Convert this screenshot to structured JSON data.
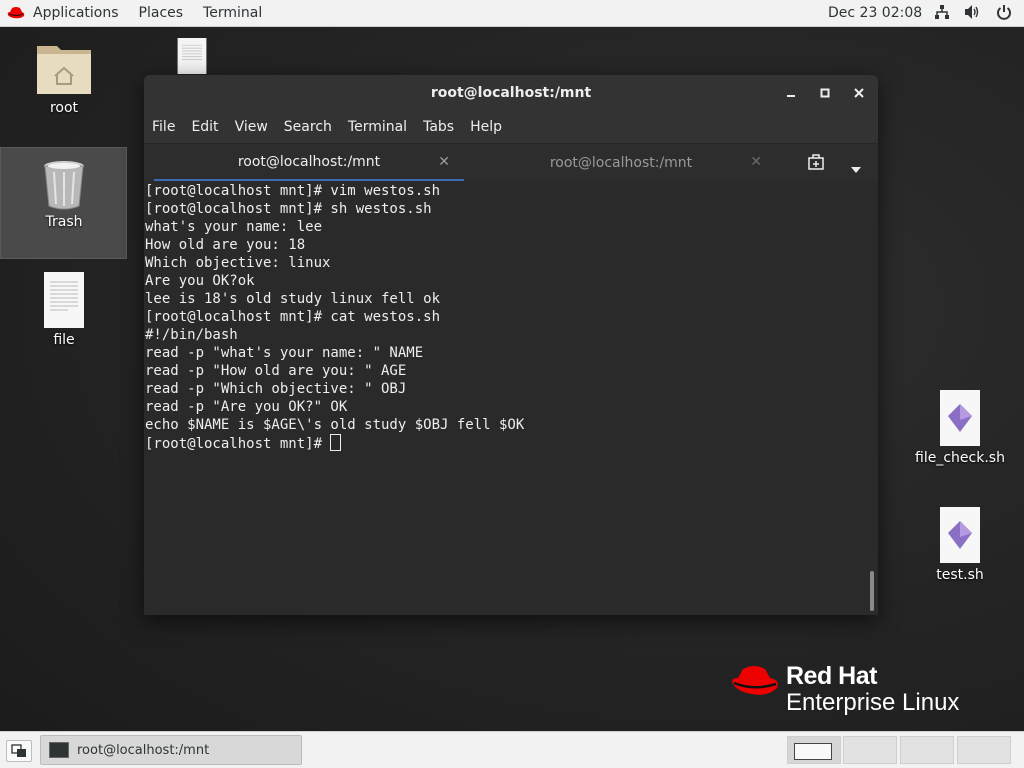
{
  "topbar": {
    "menus": [
      "Applications",
      "Places",
      "Terminal"
    ],
    "clock": "Dec 23  02:08"
  },
  "desktop": {
    "icons": [
      {
        "label": "root"
      },
      {
        "label": "Trash"
      },
      {
        "label": "file"
      },
      {
        "label": "file_check.sh"
      },
      {
        "label": "test.sh"
      }
    ]
  },
  "terminal": {
    "title": "root@localhost:/mnt",
    "menu": [
      "File",
      "Edit",
      "View",
      "Search",
      "Terminal",
      "Tabs",
      "Help"
    ],
    "tabs": [
      {
        "label": "root@localhost:/mnt",
        "active": true
      },
      {
        "label": "root@localhost:/mnt",
        "active": false
      }
    ],
    "lines": [
      "[root@localhost mnt]# vim westos.sh",
      "[root@localhost mnt]# sh westos.sh",
      "what's your name: lee",
      "How old are you: 18",
      "Which objective: linux",
      "Are you OK?ok",
      "lee is 18's old study linux fell ok",
      "[root@localhost mnt]# cat westos.sh",
      "#!/bin/bash",
      "read -p \"what's your name: \" NAME",
      "read -p \"How old are you: \" AGE",
      "read -p \"Which objective: \" OBJ",
      "read -p \"Are you OK?\" OK",
      "echo $NAME is $AGE\\'s old study $OBJ fell $OK"
    ],
    "prompt": "[root@localhost mnt]# "
  },
  "brand": {
    "line1": "Red Hat",
    "line2": "Enterprise Linux"
  },
  "taskbar": {
    "window_label": "root@localhost:/mnt"
  },
  "colors": {
    "accent": "#3c6cb0",
    "redhat_red": "#ee0000"
  }
}
